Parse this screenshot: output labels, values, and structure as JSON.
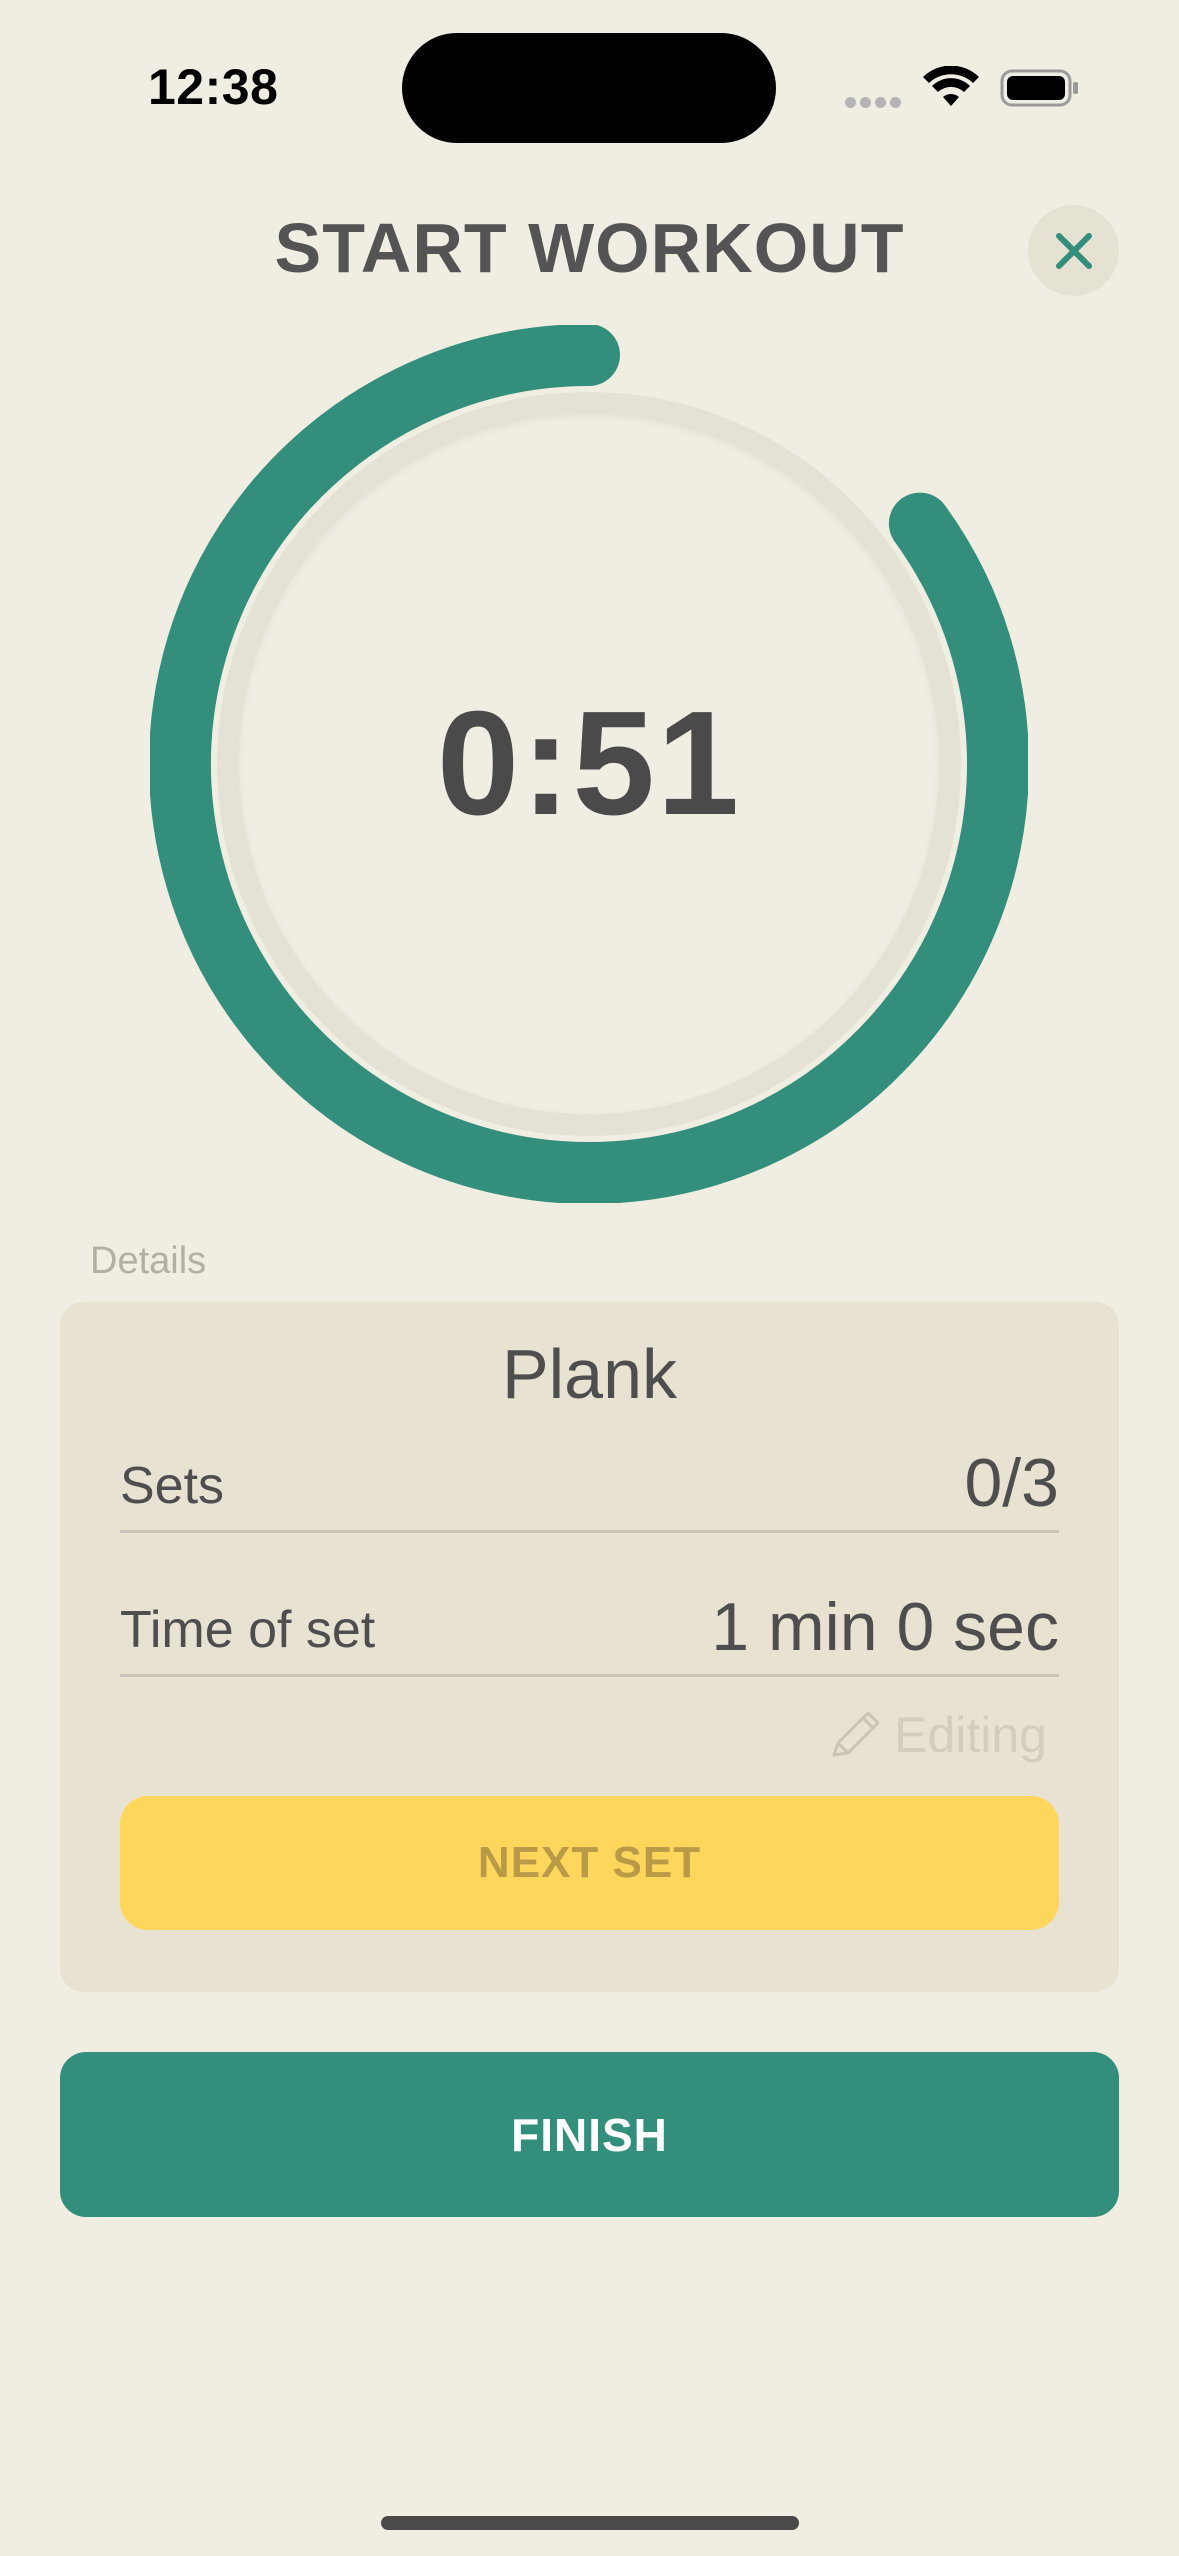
{
  "status_bar": {
    "time": "12:38",
    "icons": [
      "cellular-dots-icon",
      "wifi-icon",
      "battery-icon"
    ]
  },
  "header": {
    "title": "START WORKOUT",
    "close_icon": "close-icon"
  },
  "timer": {
    "display": "0:51",
    "progress_fraction": 0.85
  },
  "details": {
    "section_label": "Details",
    "exercise_name": "Plank",
    "rows": [
      {
        "label": "Sets",
        "value": "0/3"
      },
      {
        "label": "Time of set",
        "value": "1 min 0 sec"
      }
    ],
    "editing_label": "Editing",
    "editing_icon": "pencil-icon",
    "next_button_label": "NEXT SET"
  },
  "finish_button_label": "FINISH",
  "colors": {
    "background": "#F0EEE2",
    "accent": "#338F7C",
    "card": "#E8E2D2",
    "next_button": "#FED65C",
    "text": "#4E4E4E"
  }
}
